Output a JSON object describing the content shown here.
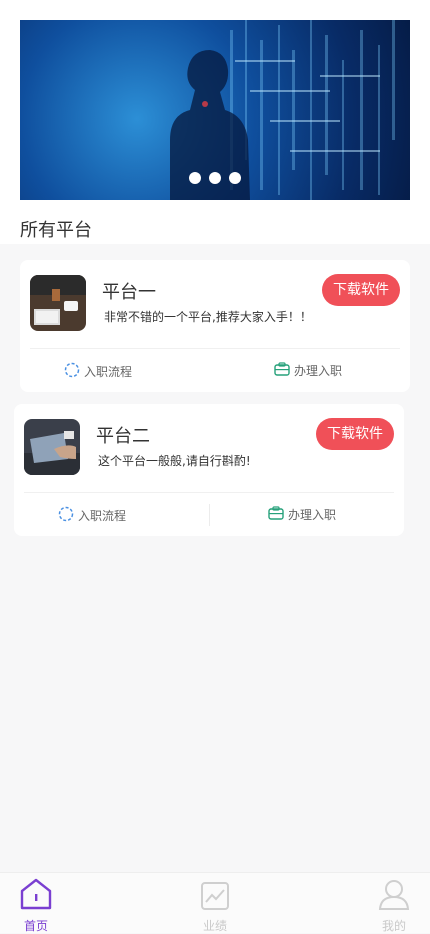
{
  "banner": {
    "dots": 3
  },
  "section": {
    "title": "所有平台"
  },
  "platforms": [
    {
      "title": "平台一",
      "description": "非常不错的一个平台,推荐大家入手！！",
      "download_label": "下载软件",
      "onboarding_label": "入职流程",
      "apply_label": "办理入职"
    },
    {
      "title": "平台二",
      "description": "这个平台一般般,请自行斟酌!",
      "download_label": "下载软件",
      "onboarding_label": "入职流程",
      "apply_label": "办理入职"
    }
  ],
  "tabbar": {
    "home": "首页",
    "performance": "业绩",
    "me": "我的"
  },
  "colors": {
    "accent": "#7a3fd1",
    "download_button": "#f05058",
    "onboarding_icon": "#4a90e2",
    "apply_icon": "#26a17a"
  }
}
